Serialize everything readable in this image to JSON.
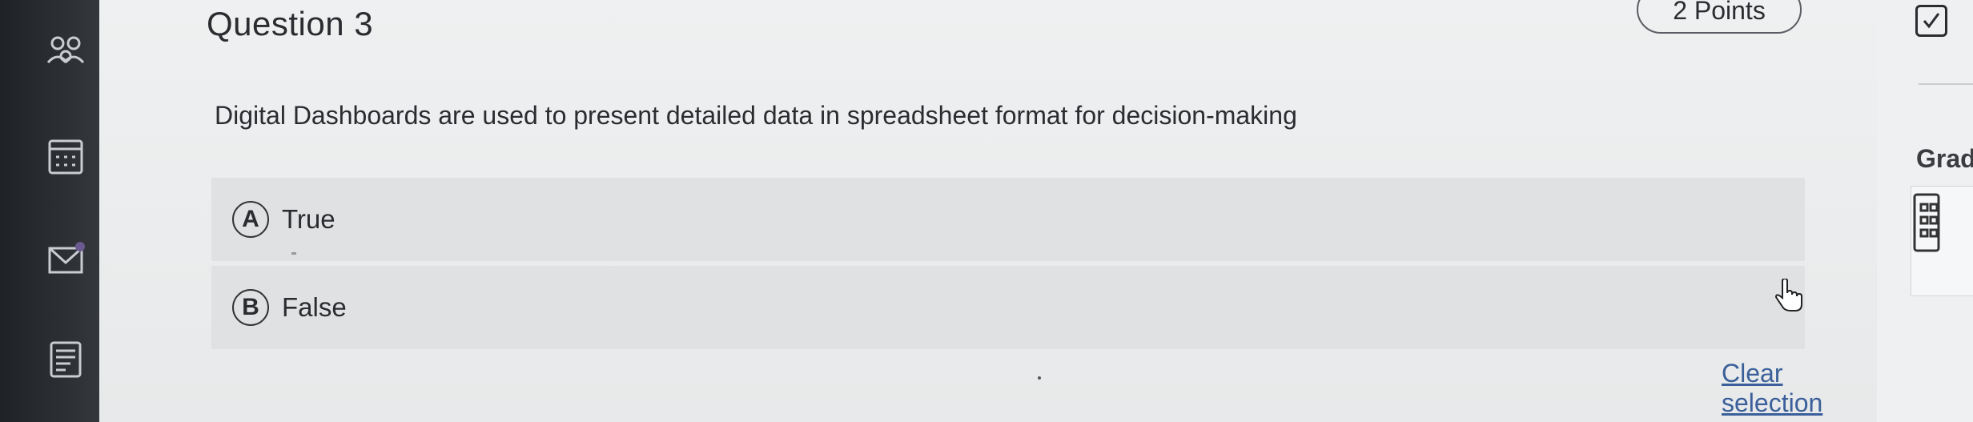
{
  "nav": {
    "icons": [
      "people-icon",
      "calendar-icon",
      "mail-icon",
      "notes-icon"
    ]
  },
  "question": {
    "title": "Question 3",
    "points": "2 Points",
    "text": "Digital Dashboards are used to present detailed data in spreadsheet format for decision-making",
    "options": [
      {
        "letter": "A",
        "label": "True"
      },
      {
        "letter": "B",
        "label": "False"
      }
    ],
    "clear_label": "Clear selection"
  },
  "right_panel": {
    "grade_label": "Grad"
  },
  "colors": {
    "link": "#3a5f9a",
    "rail": "#2b2e33",
    "option_bg": "#dfe1e2"
  }
}
